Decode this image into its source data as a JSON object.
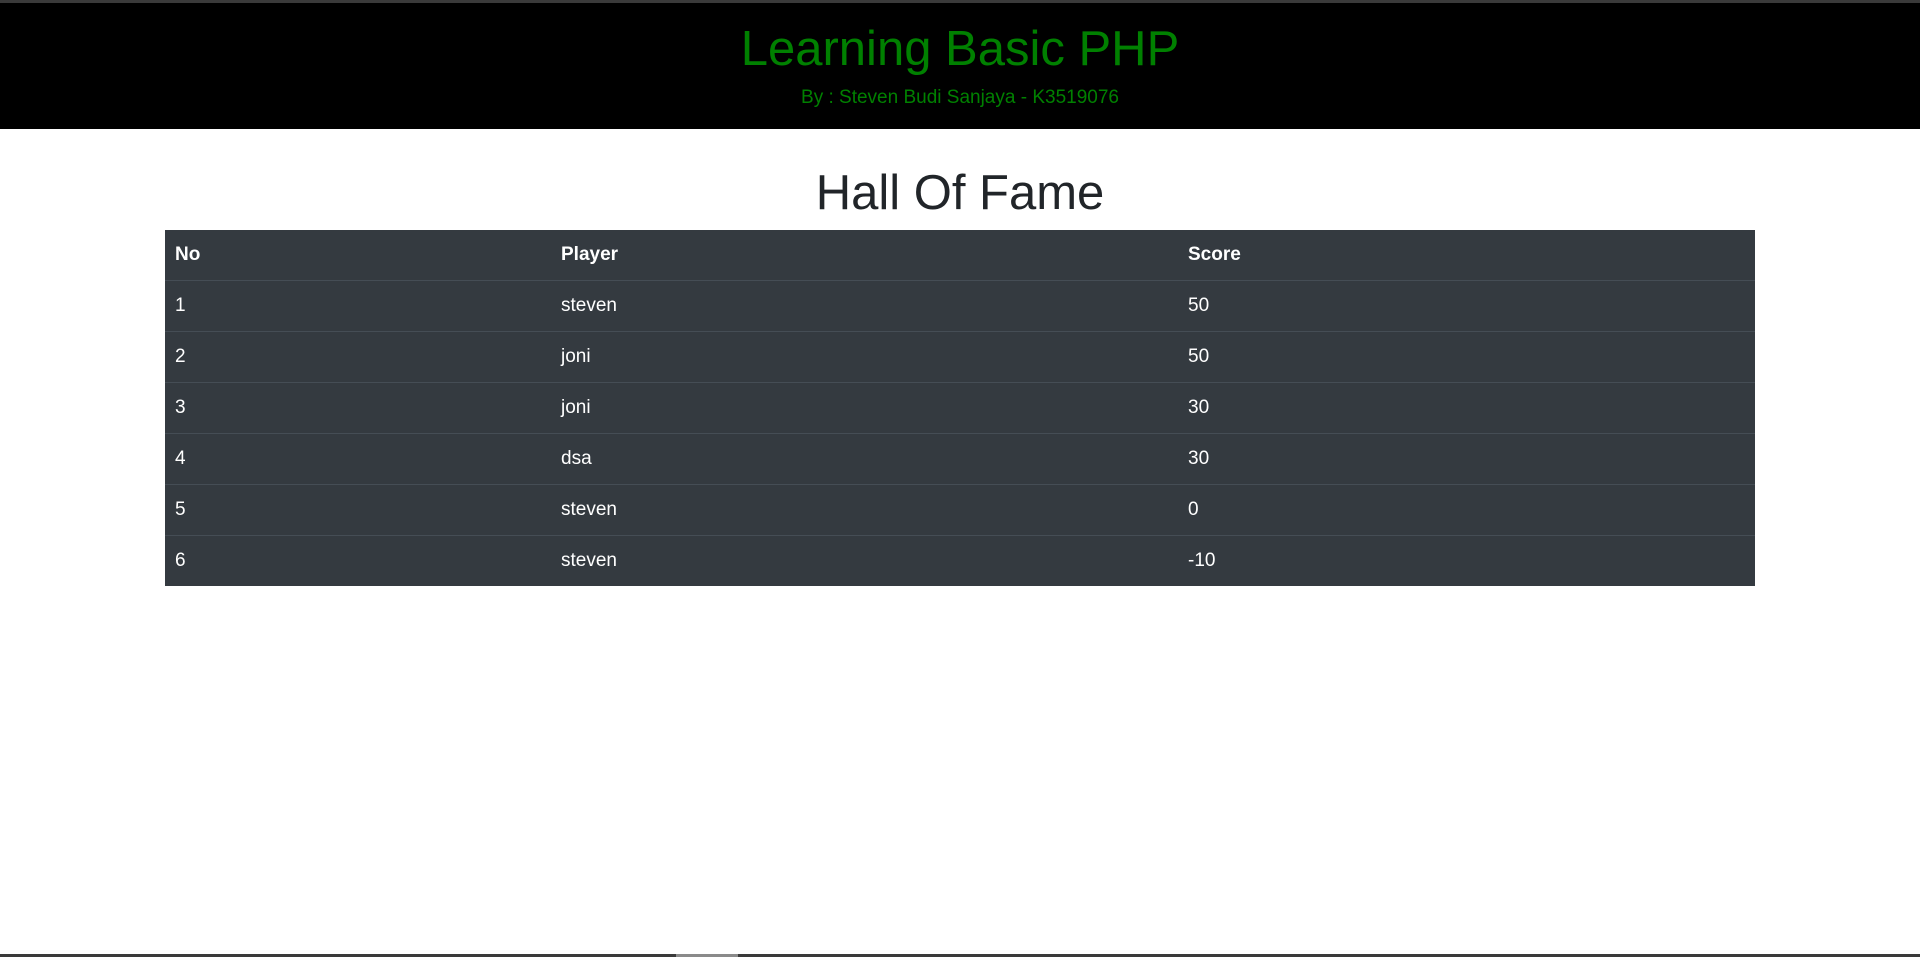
{
  "header": {
    "title": "Learning Basic PHP",
    "subtitle": "By : Steven Budi Sanjaya - K3519076"
  },
  "section": {
    "title": "Hall Of Fame"
  },
  "table": {
    "columns": [
      "No",
      "Player",
      "Score"
    ],
    "rows": [
      {
        "no": "1",
        "player": "steven",
        "score": "50"
      },
      {
        "no": "2",
        "player": "joni",
        "score": "50"
      },
      {
        "no": "3",
        "player": "joni",
        "score": "30"
      },
      {
        "no": "4",
        "player": "dsa",
        "score": "30"
      },
      {
        "no": "5",
        "player": "steven",
        "score": "0"
      },
      {
        "no": "6",
        "player": "steven",
        "score": "-10"
      }
    ]
  },
  "colors": {
    "header_bg": "#000000",
    "header_text": "#008000",
    "table_bg": "#343a40",
    "table_border": "#454d55",
    "table_text": "#ffffff",
    "heading_text": "#212529"
  }
}
